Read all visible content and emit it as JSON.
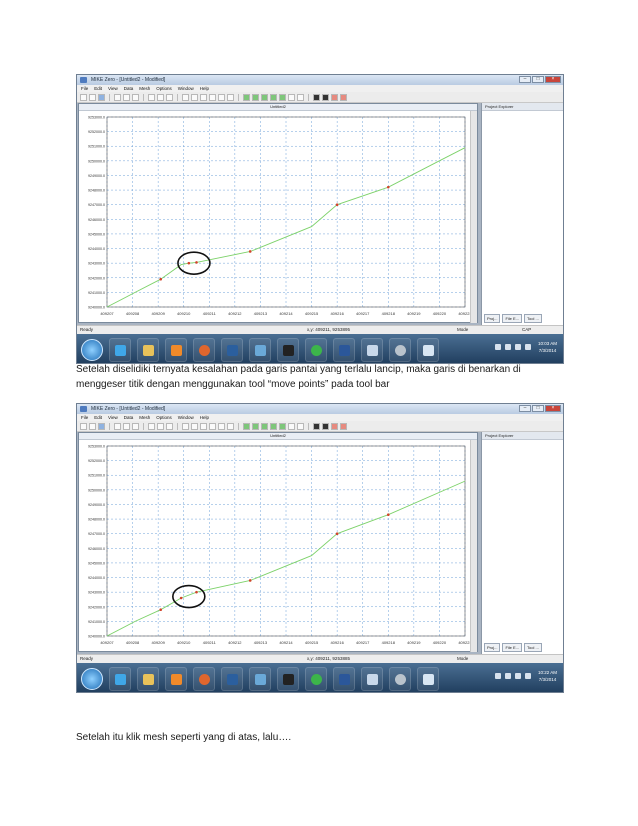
{
  "screenshots": [
    {
      "title": "MIKE Zero - [Untitled2 - Modified]",
      "doc_title": "Untitled2",
      "menu": [
        "File",
        "Edit",
        "View",
        "Data",
        "Mesh",
        "Options",
        "Window",
        "Help"
      ],
      "panel_title": "Project Explorer",
      "panel_tabs": [
        "Proj...",
        "File E...",
        "Tool ..."
      ],
      "status": {
        "ready": "Ready",
        "coords": "x,y: 409211, 9253895",
        "mode": "Mode",
        "cap": "CAP"
      },
      "clock": {
        "time": "10:03 AM",
        "date": "7/3/2014"
      },
      "y_ticks": [
        "9253000.0",
        "9252000.0",
        "9251000.0",
        "9250000.0",
        "9249000.0",
        "9248000.0",
        "9247000.0",
        "9246000.0",
        "9245000.0",
        "9244000.0",
        "9243000.0",
        "9242000.0",
        "9241000.0",
        "9240000.0"
      ],
      "x_ticks": [
        "409207",
        "409208",
        "409209",
        "409210",
        "409211",
        "409212",
        "409213",
        "409214",
        "409215",
        "409216",
        "409217",
        "409218",
        "409219",
        "409220",
        "409221"
      ],
      "line_points": [
        [
          409207.0,
          9240000.0
        ],
        [
          409208.1,
          9241000.0
        ],
        [
          409209.1,
          9241900.0
        ],
        [
          409209.9,
          9242900.0
        ],
        [
          409210.2,
          9243000.0
        ],
        [
          409210.5,
          9243050.0
        ],
        [
          409212.6,
          9243800.0
        ],
        [
          409215.0,
          9245500.0
        ],
        [
          409216.0,
          9247000.0
        ],
        [
          409218.0,
          9248200.0
        ],
        [
          409220.0,
          9250000.0
        ],
        [
          409221.0,
          9250900.0
        ]
      ],
      "node_points": [
        [
          409209.1,
          9241900.0
        ],
        [
          409210.2,
          9243000.0
        ],
        [
          409210.5,
          9243050.0
        ],
        [
          409212.6,
          9243800.0
        ],
        [
          409216.0,
          9247000.0
        ],
        [
          409218.0,
          9248200.0
        ]
      ],
      "highlight_center": [
        409210.4,
        9243000.0
      ]
    },
    {
      "title": "MIKE Zero - [Untitled2 - Modified]",
      "doc_title": "Untitled2",
      "menu": [
        "File",
        "Edit",
        "View",
        "Data",
        "Mesh",
        "Options",
        "Window",
        "Help"
      ],
      "panel_title": "Project Explorer",
      "panel_tabs": [
        "Proj...",
        "File E...",
        "Tool ..."
      ],
      "status": {
        "ready": "Ready",
        "coords": "x,y: 409211, 9253885",
        "mode": "Mode",
        "cap": ""
      },
      "clock": {
        "time": "10:22 AM",
        "date": "7/3/2014"
      },
      "y_ticks": [
        "9253000.0",
        "9252000.0",
        "9251000.0",
        "9250000.0",
        "9249000.0",
        "9248000.0",
        "9247000.0",
        "9246000.0",
        "9245000.0",
        "9244000.0",
        "9243000.0",
        "9242000.0",
        "9241000.0",
        "9240000.0"
      ],
      "x_ticks": [
        "409207",
        "409208",
        "409209",
        "409210",
        "409211",
        "409212",
        "409213",
        "409214",
        "409215",
        "409216",
        "409217",
        "409218",
        "409219",
        "409220",
        "409221"
      ],
      "line_points": [
        [
          409207.0,
          9240000.0
        ],
        [
          409208.1,
          9241000.0
        ],
        [
          409209.1,
          9241800.0
        ],
        [
          409209.9,
          9242600.0
        ],
        [
          409210.5,
          9243000.0
        ],
        [
          409212.6,
          9243800.0
        ],
        [
          409215.0,
          9245500.0
        ],
        [
          409216.0,
          9247000.0
        ],
        [
          409218.0,
          9248300.0
        ],
        [
          409221.0,
          9250600.0
        ]
      ],
      "node_points": [
        [
          409209.1,
          9241800.0
        ],
        [
          409209.9,
          9242600.0
        ],
        [
          409210.5,
          9243000.0
        ],
        [
          409212.6,
          9243800.0
        ],
        [
          409216.0,
          9247000.0
        ],
        [
          409218.0,
          9248300.0
        ]
      ],
      "highlight_center": [
        409210.2,
        9242700.0
      ]
    }
  ],
  "captions": [
    "Setelah diselidiki ternyata kesalahan pada garis pantai yang terlalu lancip, maka garis di benarkan di menggeser titik dengan menggunakan tool “move points” pada tool bar",
    "Setelah itu klik mesh seperti yang di atas, lalu…."
  ],
  "colors": {
    "line": "#7dd26a",
    "node": "#d2442b",
    "grid": "#6ea0d8",
    "circle": "#111111"
  }
}
